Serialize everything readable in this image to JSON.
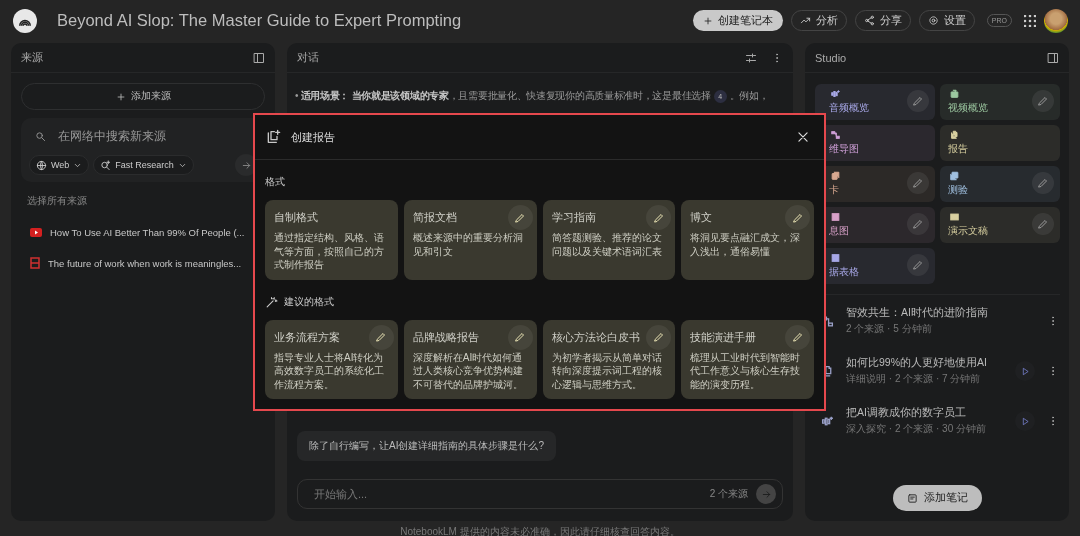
{
  "app_bar": {
    "title": "Beyond AI Slop: The Master Guide to Expert Prompting",
    "create_button": "创建笔记本",
    "actions": [
      {
        "kind": "analytics",
        "label": "分析"
      },
      {
        "kind": "share",
        "label": "分享"
      },
      {
        "kind": "settings",
        "label": "设置"
      }
    ],
    "badge": "PRO"
  },
  "sources": {
    "title": "来源",
    "add_button": "添加来源",
    "search": {
      "placeholder": "在网络中搜索新来源"
    },
    "chips": [
      {
        "kind": "web",
        "label": "Web"
      },
      {
        "kind": "research",
        "label": "Fast Research"
      }
    ],
    "select_all": "选择所有来源",
    "items": [
      {
        "kind": "youtube",
        "title": "How To Use AI Better Than 99% Of People (..."
      },
      {
        "kind": "doc",
        "title": "The future of work when work is meaningles..."
      }
    ]
  },
  "chat": {
    "title": "对话",
    "message": "• **适用场景：** **当你就是该领域的专家**，且需要批量化、快速复现你的高质量标准时，这是最佳选择",
    "citation": "4",
    "message_tail": "。例如，",
    "suggestion": "除了自行编写，让AI创建详细指南的具体步骤是什么?",
    "input": {
      "placeholder": "开始输入..."
    },
    "source_count": "2 个来源",
    "footer": "NotebookLM 提供的内容未必准确，因此请仔细核查回答内容。"
  },
  "studio": {
    "title": "Studio",
    "tiles": [
      {
        "kind": "audio",
        "label": "音频概览",
        "color": "#a8a8e8",
        "editable": true
      },
      {
        "kind": "video",
        "label": "视频概览",
        "color": "#9cc8a0",
        "editable": true
      },
      {
        "kind": "mindmap",
        "label": "维导图",
        "color": "#d0a0d8",
        "editable": false
      },
      {
        "kind": "report",
        "label": "报告",
        "color": "#d8d0a0",
        "editable": false
      },
      {
        "kind": "flashcard",
        "label": "卡",
        "color": "#d8a890",
        "editable": true
      },
      {
        "kind": "quiz",
        "label": "测验",
        "color": "#a0c0e0",
        "editable": true
      },
      {
        "kind": "infographic",
        "label": "息图",
        "color": "#d8a0c8",
        "editable": true
      },
      {
        "kind": "slides",
        "label": "演示文稿",
        "color": "#d8d0a0",
        "editable": true
      },
      {
        "kind": "table",
        "label": "据表格",
        "color": "#a8a8e8",
        "editable": true
      }
    ],
    "notes": [
      {
        "kind": "mindmap",
        "title": "智效共生：AI时代的进阶指南",
        "meta": "2 个来源 · 5 分钟前",
        "playable": false
      },
      {
        "kind": "report",
        "title": "如何比99%的人更好地使用AI",
        "meta": "详细说明 · 2 个来源 · 7 分钟前",
        "playable": true
      },
      {
        "kind": "audio",
        "title": "把AI调教成你的数字员工",
        "meta": "深入探究 · 2 个来源 · 30 分钟前",
        "playable": true
      }
    ],
    "add_note_button": "添加笔记"
  },
  "dialog": {
    "title": "创建报告",
    "sections": [
      {
        "kind": "formats",
        "label": "格式",
        "cards": [
          {
            "title": "自制格式",
            "description": "通过指定结构、风格、语气等方面，按照自己的方式制作报告",
            "editable": false
          },
          {
            "title": "简报文档",
            "description": "概述来源中的重要分析洞见和引文",
            "editable": true
          },
          {
            "title": "学习指南",
            "description": "简答题测验、推荐的论文问题以及关键术语词汇表",
            "editable": true
          },
          {
            "title": "博文",
            "description": "将洞见要点融汇成文，深入浅出，通俗易懂",
            "editable": true
          }
        ]
      },
      {
        "kind": "suggested",
        "label": "建议的格式",
        "cards": [
          {
            "title": "业务流程方案",
            "description": "指导专业人士将AI转化为高效数字员工的系统化工作流程方案。",
            "editable": true
          },
          {
            "title": "品牌战略报告",
            "description": "深度解析在AI时代如何通过人类核心竞争优势构建不可替代的品牌护城河。",
            "editable": true
          },
          {
            "title": "核心方法论白皮书",
            "description": "为初学者揭示从简单对话转向深度提示词工程的核心逻辑与思维方式。",
            "editable": true
          },
          {
            "title": "技能演进手册",
            "description": "梳理从工业时代到智能时代工作意义与核心生存技能的演变历程。",
            "editable": true
          }
        ]
      }
    ]
  }
}
